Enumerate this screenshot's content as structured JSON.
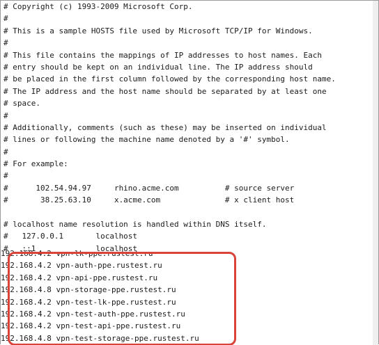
{
  "file": {
    "comment_lines": [
      "# Copyright (c) 1993-2009 Microsoft Corp.",
      "#",
      "# This is a sample HOSTS file used by Microsoft TCP/IP for Windows.",
      "#",
      "# This file contains the mappings of IP addresses to host names. Each",
      "# entry should be kept on an individual line. The IP address should",
      "# be placed in the first column followed by the corresponding host name.",
      "# The IP address and the host name should be separated by at least one",
      "# space.",
      "#",
      "# Additionally, comments (such as these) may be inserted on individual",
      "# lines or following the machine name denoted by a '#' symbol.",
      "#",
      "# For example:",
      "#",
      "#      102.54.94.97     rhino.acme.com          # source server",
      "#       38.25.63.10     x.acme.com              # x client host",
      "",
      "# localhost name resolution is handled within DNS itself.",
      "#   127.0.0.1       localhost",
      "#   ::1             localhost"
    ],
    "host_entries": [
      "192.168.4.2 vpn-lk-ppe.rustest.ru",
      "192.168.4.2 vpn-auth-ppe.rustest.ru",
      "192.168.4.2 vpn-api-ppe.rustest.ru",
      "192.168.4.8 vpn-storage-ppe.rustest.ru",
      "192.168.4.2 vpn-test-lk-ppe.rustest.ru",
      "192.168.4.2 vpn-test-auth-ppe.rustest.ru",
      "192.168.4.2 vpn-test-api-ppe.rustest.ru",
      "192.168.4.8 vpn-test-storage-ppe.rustest.ru"
    ]
  },
  "colors": {
    "highlight_border": "#d9433a",
    "text": "#1a1a1a",
    "background": "#ffffff"
  }
}
